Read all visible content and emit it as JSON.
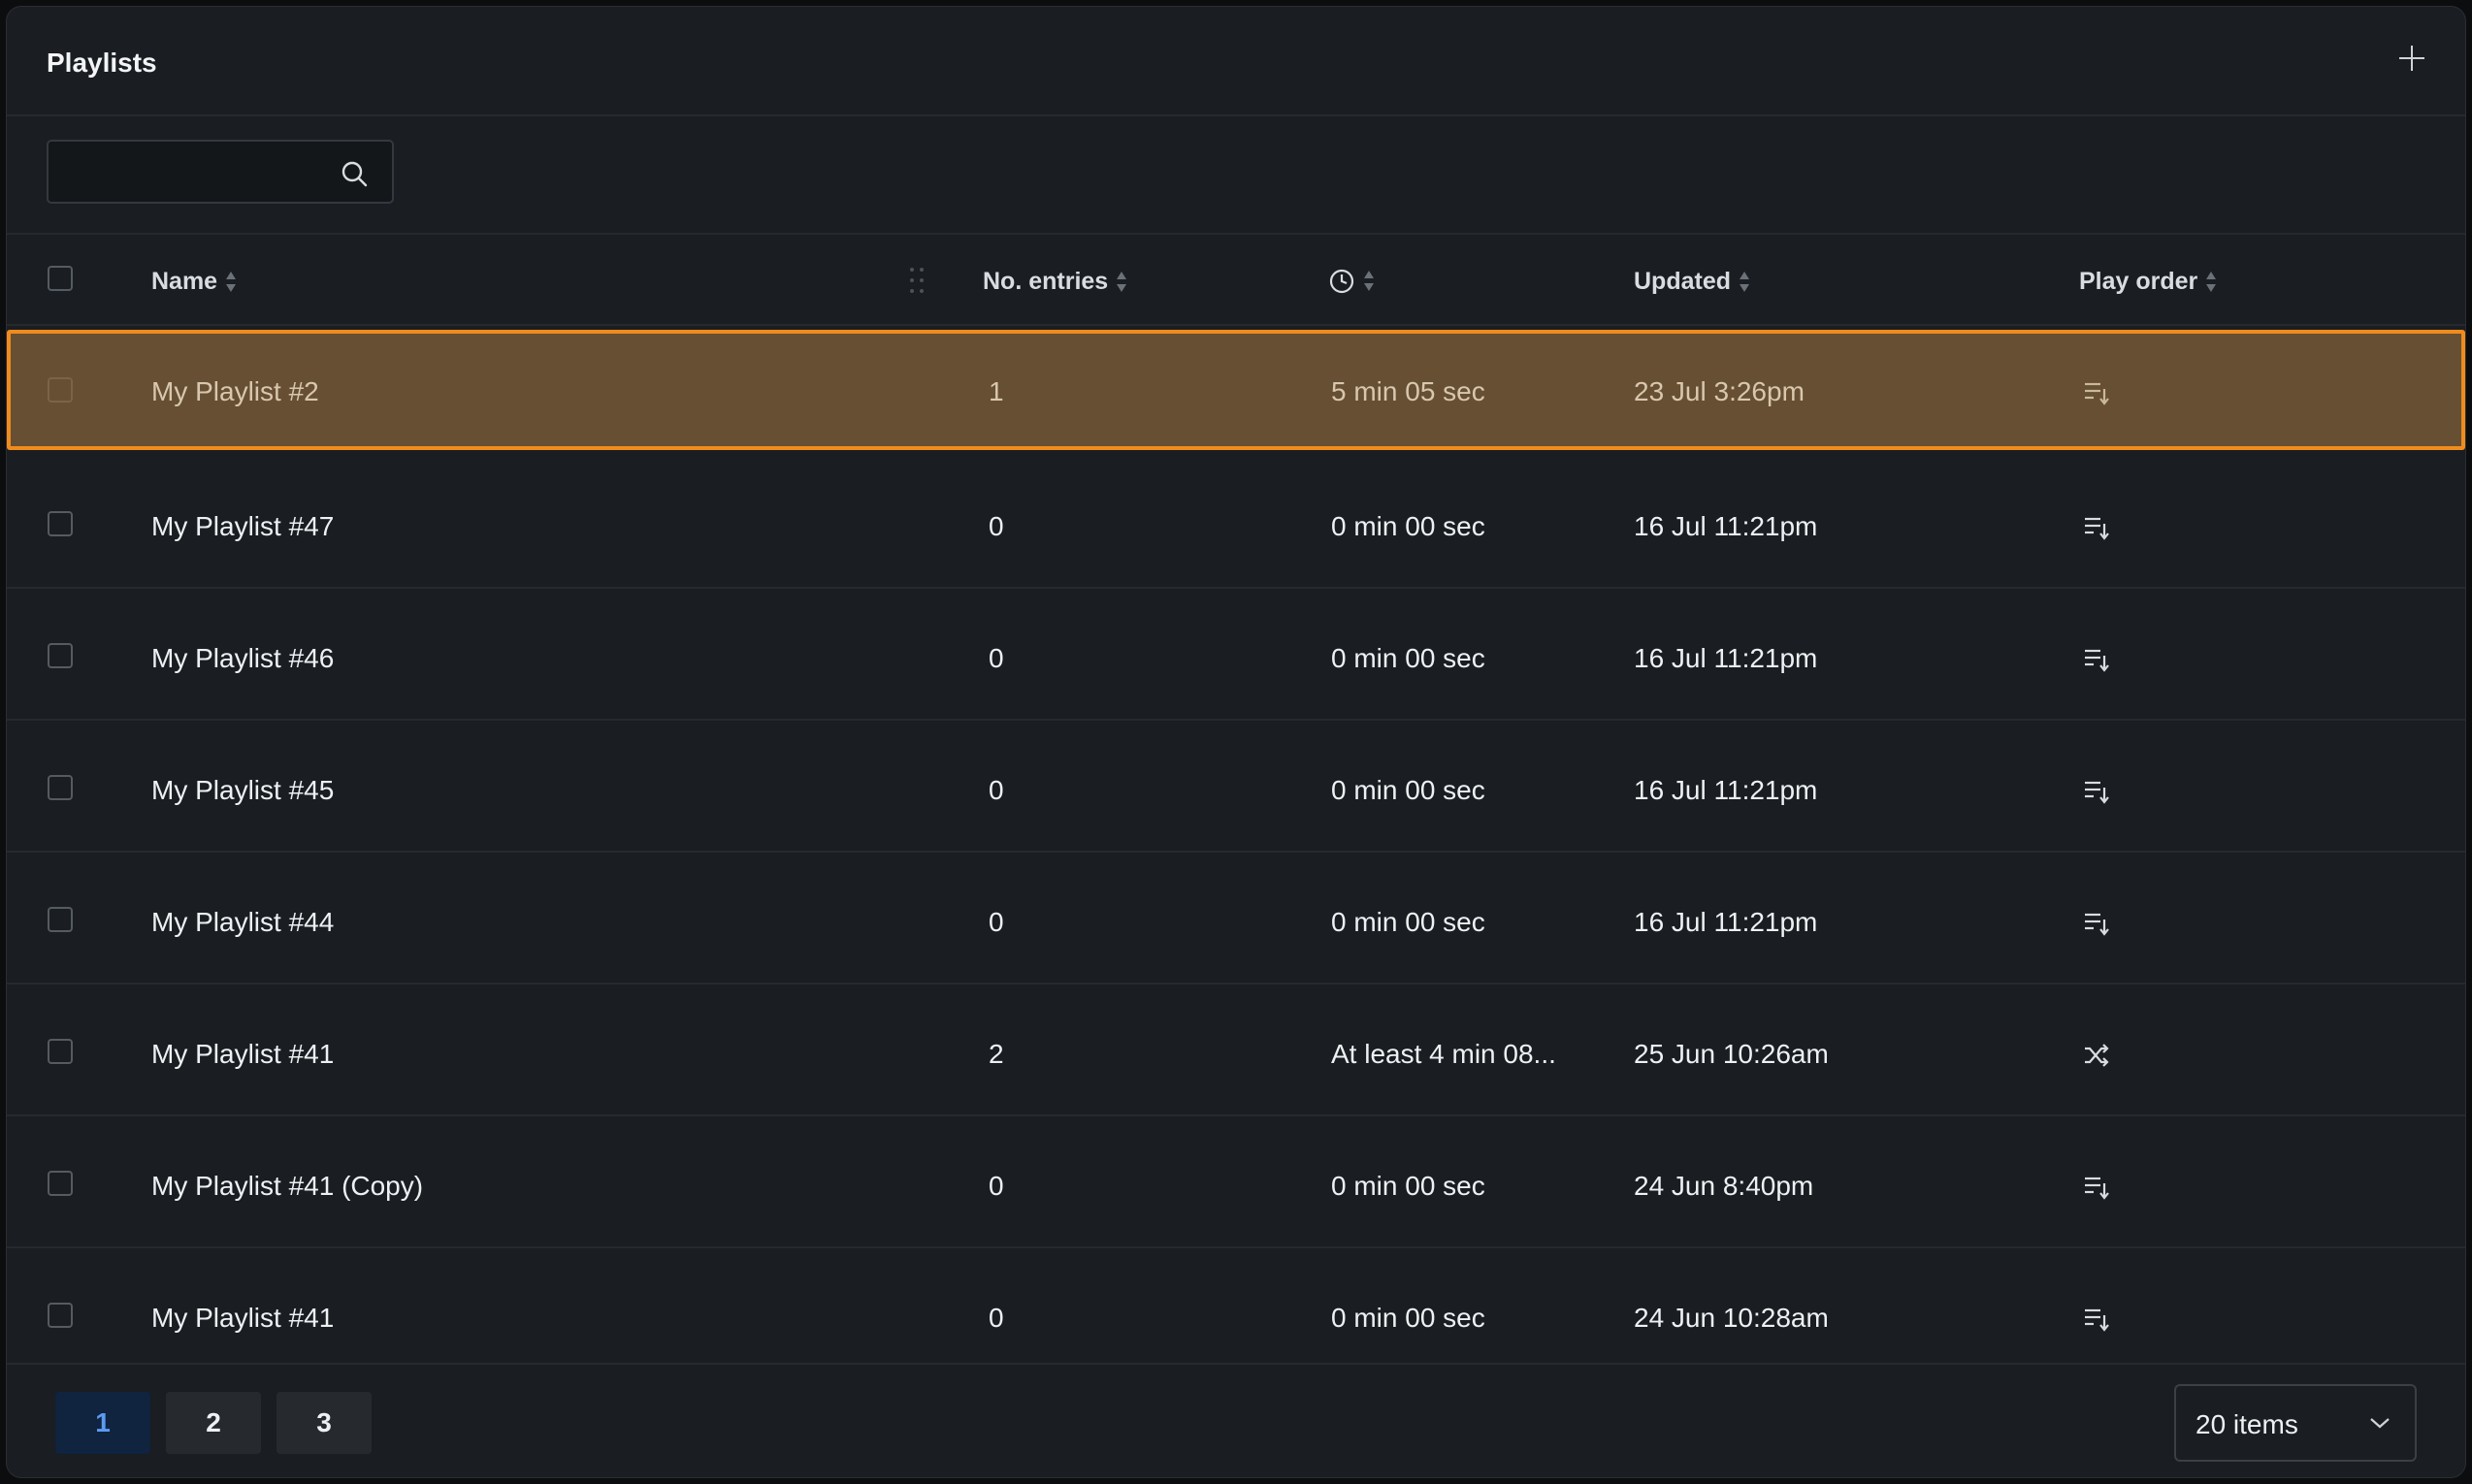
{
  "header": {
    "title": "Playlists",
    "add_icon": "plus-icon"
  },
  "search": {
    "value": "",
    "placeholder": "",
    "icon": "search-icon"
  },
  "columns": {
    "name": "Name",
    "entries": "No. entries",
    "duration_icon": "clock-icon",
    "updated": "Updated",
    "play_order": "Play order"
  },
  "rows": [
    {
      "name": "My Playlist #2",
      "entries": "1",
      "duration": "5 min 05 sec",
      "updated": "23 Jul 3:26pm",
      "order_icon": "sequential-order-icon",
      "selected": true
    },
    {
      "name": "My Playlist #47",
      "entries": "0",
      "duration": "0 min 00 sec",
      "updated": "16 Jul 11:21pm",
      "order_icon": "sequential-order-icon"
    },
    {
      "name": "My Playlist #46",
      "entries": "0",
      "duration": "0 min 00 sec",
      "updated": "16 Jul 11:21pm",
      "order_icon": "sequential-order-icon"
    },
    {
      "name": "My Playlist #45",
      "entries": "0",
      "duration": "0 min 00 sec",
      "updated": "16 Jul 11:21pm",
      "order_icon": "sequential-order-icon"
    },
    {
      "name": "My Playlist #44",
      "entries": "0",
      "duration": "0 min 00 sec",
      "updated": "16 Jul 11:21pm",
      "order_icon": "sequential-order-icon"
    },
    {
      "name": "My Playlist #41",
      "entries": "2",
      "duration": "At least 4 min 08...",
      "updated": "25 Jun 10:26am",
      "order_icon": "shuffle-icon"
    },
    {
      "name": "My Playlist #41 (Copy)",
      "entries": "0",
      "duration": "0 min 00 sec",
      "updated": "24 Jun 8:40pm",
      "order_icon": "sequential-order-icon"
    },
    {
      "name": "My Playlist #41",
      "entries": "0",
      "duration": "0 min 00 sec",
      "updated": "24 Jun 10:28am",
      "order_icon": "sequential-order-icon"
    }
  ],
  "pagination": {
    "pages": [
      "1",
      "2",
      "3"
    ],
    "current": "1"
  },
  "page_size": {
    "value": "20 items"
  },
  "colors": {
    "accent": "#f08c1e",
    "selected_row": "#664f33",
    "active_page": "#5b9cf0"
  }
}
